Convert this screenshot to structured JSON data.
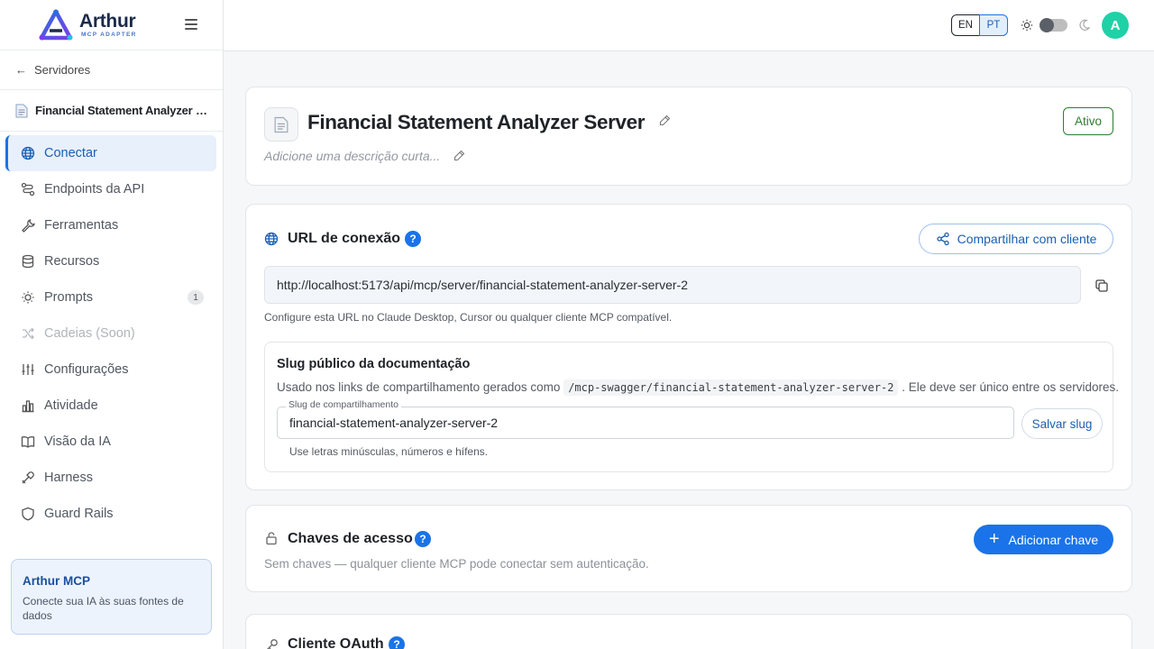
{
  "brand": {
    "name": "Arthur",
    "sub": "MCP ADAPTER"
  },
  "sidebar": {
    "back_label": "Servidores",
    "server_name": "Financial Statement Analyzer Server",
    "items": [
      {
        "label": "Conectar",
        "icon": "globe-icon",
        "active": true
      },
      {
        "label": "Endpoints da API",
        "icon": "route-icon"
      },
      {
        "label": "Ferramentas",
        "icon": "wrench-icon"
      },
      {
        "label": "Recursos",
        "icon": "database-icon"
      },
      {
        "label": "Prompts",
        "icon": "lightbulb-icon",
        "badge": "1"
      },
      {
        "label": "Cadeias (Soon)",
        "icon": "chain-icon",
        "disabled": true
      },
      {
        "label": "Configurações",
        "icon": "sliders-icon"
      },
      {
        "label": "Atividade",
        "icon": "bar-chart-icon"
      },
      {
        "label": "Visão da IA",
        "icon": "book-icon"
      },
      {
        "label": "Harness",
        "icon": "harness-icon"
      },
      {
        "label": "Guard Rails",
        "icon": "shield-icon"
      }
    ],
    "promo": {
      "title": "Arthur MCP",
      "desc": "Conecte sua IA às suas fontes de dados"
    }
  },
  "topbar": {
    "lang_en": "EN",
    "lang_pt": "PT",
    "avatar": "A"
  },
  "server": {
    "title": "Financial Statement Analyzer Server",
    "desc_placeholder": "Adicione uma descrição curta...",
    "status": "Ativo"
  },
  "connection": {
    "title": "URL de conexão",
    "share_label": "Compartilhar com cliente",
    "url": "http://localhost:5173/api/mcp/server/financial-statement-analyzer-server-2",
    "hint": "Configure esta URL no Claude Desktop, Cursor ou qualquer cliente MCP compatível.",
    "slug": {
      "title": "Slug público da documentação",
      "desc_pre": "Usado nos links de compartilhamento gerados como",
      "desc_code": "/mcp-swagger/financial-statement-analyzer-server-2",
      "desc_post": ". Ele deve ser único entre os servidores.",
      "field_label": "Slug de compartilhamento",
      "value": "financial-statement-analyzer-server-2",
      "save_label": "Salvar slug",
      "hint": "Use letras minúsculas, números e hífens."
    }
  },
  "keys": {
    "title": "Chaves de acesso",
    "add_label": "Adicionar chave",
    "desc": "Sem chaves — qualquer cliente MCP pode conectar sem autenticação."
  },
  "oauth": {
    "title": "Cliente OAuth"
  },
  "colors": {
    "accent": "#1a73e8",
    "active_status": "#2e7d32",
    "avatar": "#1fd1a6"
  }
}
